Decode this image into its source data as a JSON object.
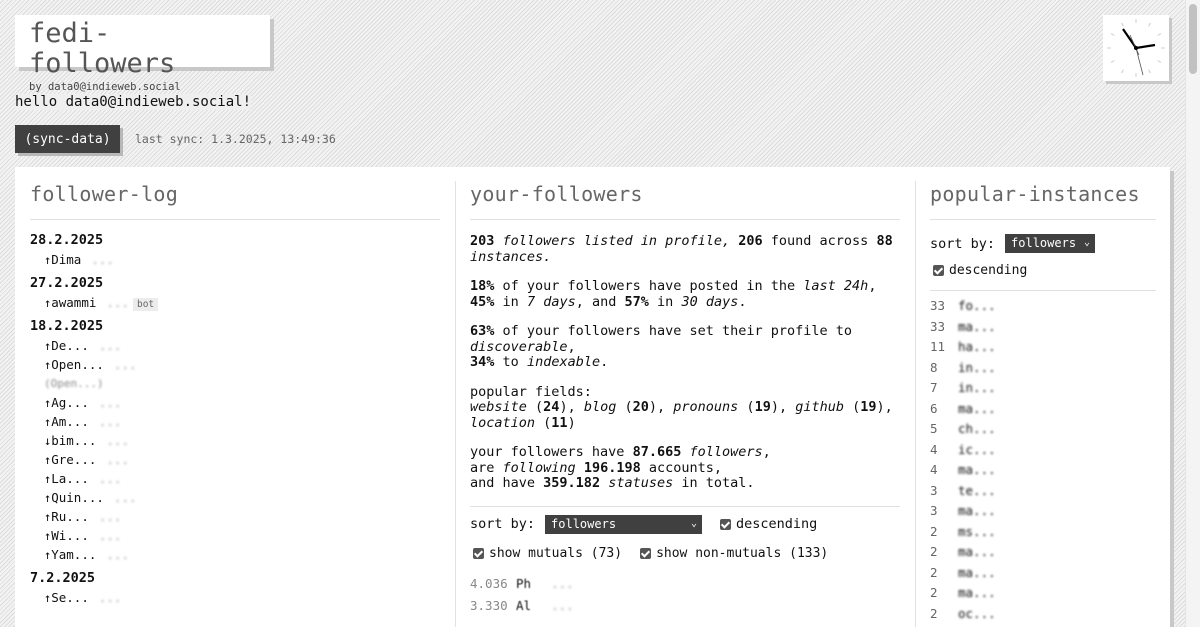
{
  "header": {
    "title": "fedi-followers",
    "by": "by data0@indieweb.social",
    "hello": "hello data0@indieweb.social!",
    "sync_button": "(sync-data)",
    "last_sync": "last sync: 1.3.2025, 13:49:36"
  },
  "follower_log": {
    "title": "follower-log",
    "groups": [
      {
        "date": "28.2.2025",
        "entries": [
          {
            "arrow": "↑",
            "name": "Dima",
            "detail": "..."
          }
        ]
      },
      {
        "date": "27.2.2025",
        "entries": [
          {
            "arrow": "↑",
            "name": "awammi",
            "detail": "...",
            "badge": "bot"
          }
        ]
      },
      {
        "date": "18.2.2025",
        "entries": [
          {
            "arrow": "↑",
            "name": "De...",
            "detail": "..."
          },
          {
            "arrow": "↑",
            "name": "Open...",
            "detail": "..."
          },
          {
            "arrow": "",
            "name": "",
            "detail": "(Open...)",
            "note": true
          },
          {
            "arrow": "↑",
            "name": "Ag...",
            "detail": "..."
          },
          {
            "arrow": "↑",
            "name": "Am...",
            "detail": "..."
          },
          {
            "arrow": "↓",
            "name": "bim...",
            "detail": "..."
          },
          {
            "arrow": "↑",
            "name": "Gre...",
            "detail": "..."
          },
          {
            "arrow": "↑",
            "name": "La...",
            "detail": "..."
          },
          {
            "arrow": "↑",
            "name": "Quin...",
            "detail": "..."
          },
          {
            "arrow": "↑",
            "name": "Ru...",
            "detail": "..."
          },
          {
            "arrow": "↑",
            "name": "Wi...",
            "detail": "..."
          },
          {
            "arrow": "↑",
            "name": "Yam...",
            "detail": "..."
          }
        ]
      },
      {
        "date": "7.2.2025",
        "entries": [
          {
            "arrow": "↑",
            "name": "Se...",
            "detail": "..."
          }
        ]
      }
    ]
  },
  "your_followers": {
    "title": "your-followers",
    "stats": {
      "listed": "203",
      "found": "206",
      "instances": "88",
      "pct_24h": "18%",
      "pct_7d": "45%",
      "pct_30d": "57%",
      "pct_discoverable": "63%",
      "pct_indexable": "34%",
      "field_website": "24",
      "field_blog": "20",
      "field_pronouns": "19",
      "field_github": "19",
      "field_location": "11",
      "total_followers": "87.665",
      "total_following": "196.198",
      "total_statuses": "359.182"
    },
    "text": {
      "followers_listed_in_profile": "followers listed in profile,",
      "found_across": "found across",
      "instances_word": "instances.",
      "of_your_followers_posted": "of your followers have posted in the",
      "last_24h": "last 24h",
      "in_word": "in",
      "seven_days": "7 days",
      "and_word": ", and",
      "thirty_days": "30 days",
      "set_profile_to": "of your followers have set their profile to",
      "discoverable": "discoverable",
      "to_word": "to",
      "indexable": "indexable",
      "popular_fields": "popular fields:",
      "website": "website",
      "blog": "blog",
      "pronouns": "pronouns",
      "github": "github",
      "location": "location",
      "your_followers_have": "your followers have",
      "followers_word": "followers",
      "are_following": "are following",
      "accounts": "accounts,",
      "and_have": "and have",
      "statuses": "statuses",
      "in_total": "in total."
    },
    "sort_label": "sort by:",
    "sort_value": "followers",
    "descending_label": "descending",
    "show_mutuals": "show mutuals (73)",
    "show_non_mutuals": "show non-mutuals (133)",
    "rows": [
      {
        "count": "4.036",
        "name": "Ph",
        "detail": "..."
      },
      {
        "count": "3.330",
        "name": "Al",
        "detail": "..."
      }
    ]
  },
  "popular_instances": {
    "title": "popular-instances",
    "sort_label": "sort by:",
    "sort_value": "followers",
    "descending_label": "descending",
    "rows": [
      {
        "count": "33",
        "name": "fo..."
      },
      {
        "count": "33",
        "name": "ma..."
      },
      {
        "count": "11",
        "name": "ha..."
      },
      {
        "count": "8",
        "name": "in..."
      },
      {
        "count": "7",
        "name": "in..."
      },
      {
        "count": "6",
        "name": "ma..."
      },
      {
        "count": "5",
        "name": "ch..."
      },
      {
        "count": "4",
        "name": "ic..."
      },
      {
        "count": "4",
        "name": "ma..."
      },
      {
        "count": "3",
        "name": "te..."
      },
      {
        "count": "3",
        "name": "ma..."
      },
      {
        "count": "2",
        "name": "ms..."
      },
      {
        "count": "2",
        "name": "ma..."
      },
      {
        "count": "2",
        "name": "ma..."
      },
      {
        "count": "2",
        "name": "ma..."
      },
      {
        "count": "2",
        "name": "oc..."
      }
    ]
  }
}
